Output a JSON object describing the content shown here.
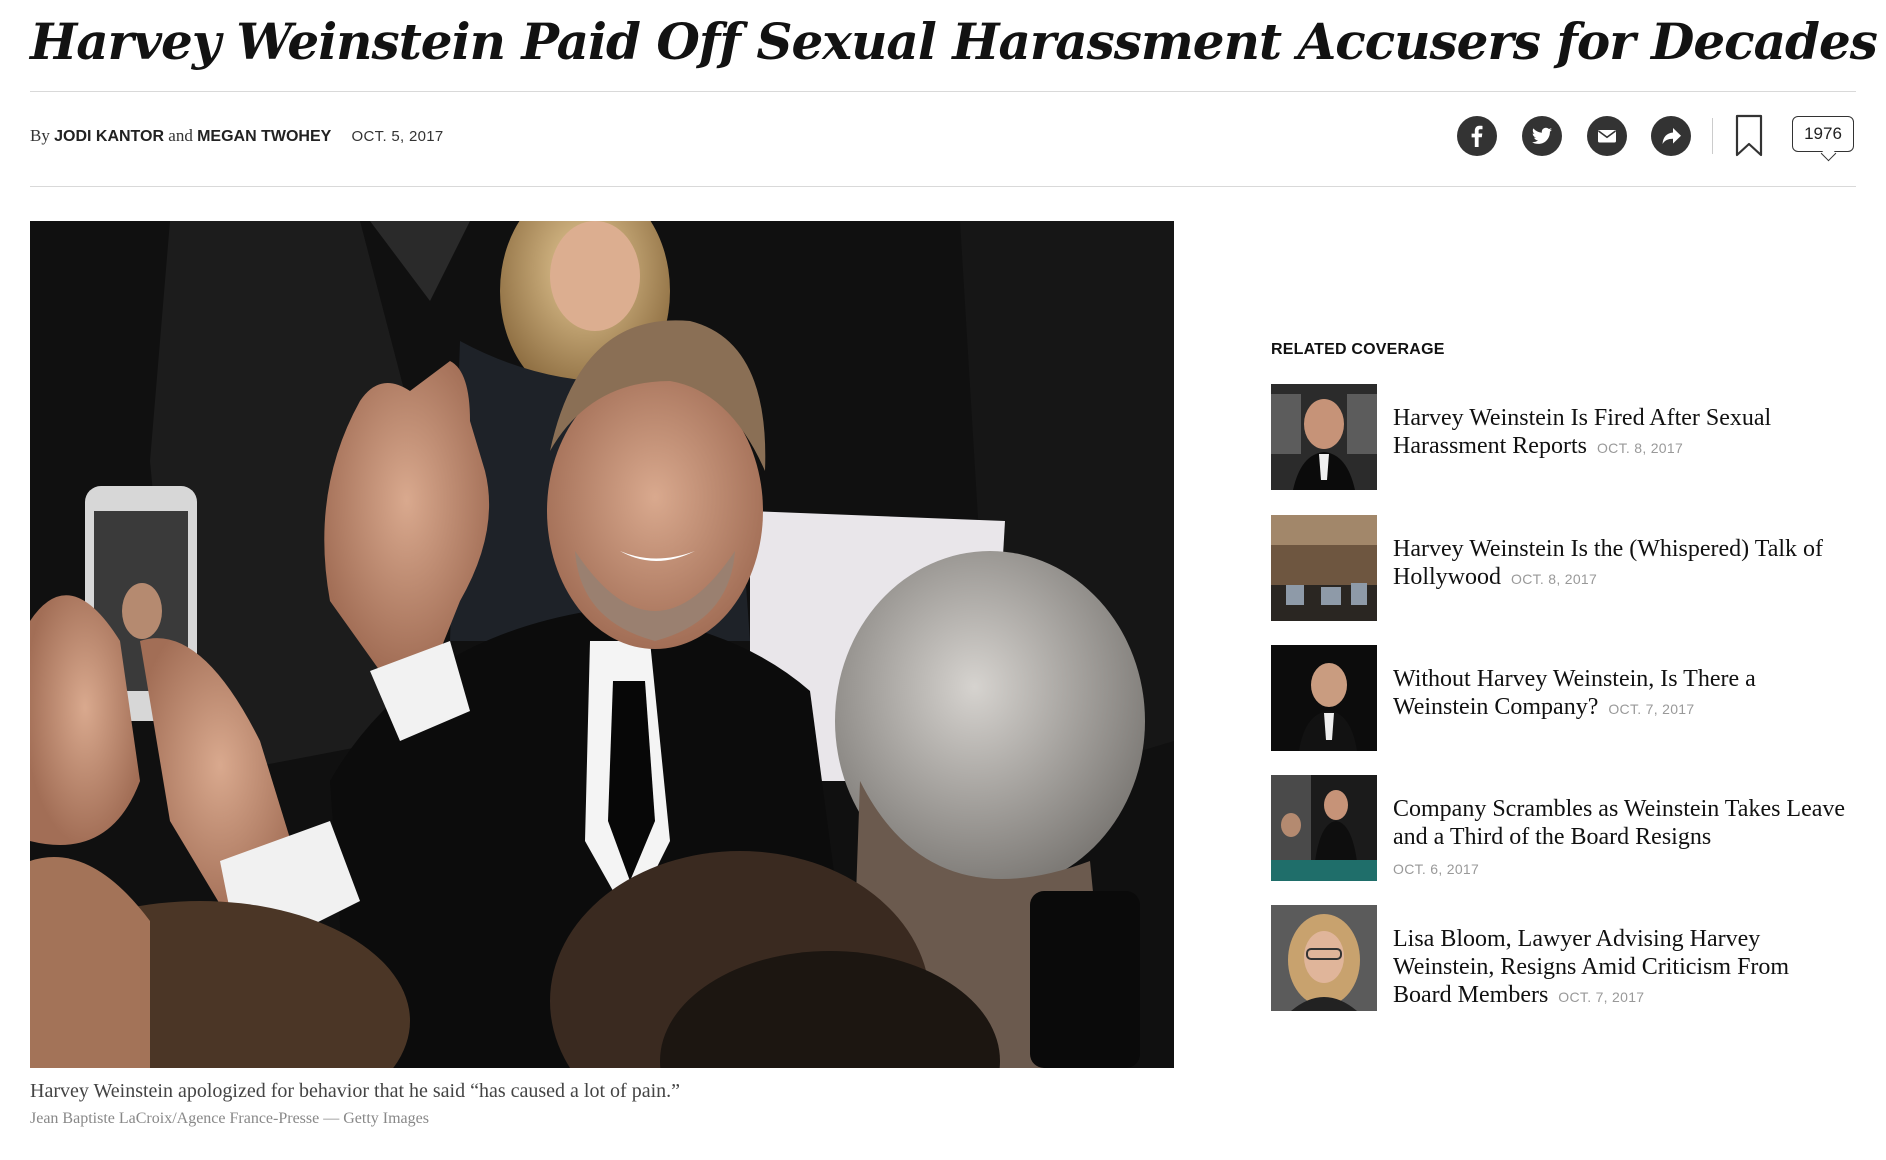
{
  "article": {
    "headline": "Harvey Weinstein Paid Off Sexual Harassment Accusers for Decades",
    "byline_prefix": "By",
    "author1": "JODI KANTOR",
    "byline_and": "and",
    "author2": "MEGAN TWOHEY",
    "date": "OCT. 5, 2017"
  },
  "toolbar": {
    "share_icons": [
      "facebook-icon",
      "twitter-icon",
      "email-icon",
      "share-icon"
    ],
    "bookmark_icon": "bookmark-icon",
    "comment_count": "1976"
  },
  "photo": {
    "caption": "Harvey Weinstein apologized for behavior that he said “has caused a lot of pain.”",
    "credit": "Jean Baptiste LaCroix/Agence France-Presse — Getty Images"
  },
  "related": {
    "label": "RELATED COVERAGE",
    "items": [
      {
        "title": "Harvey Weinstein Is Fired After Sexual Harassment Reports",
        "date": "OCT. 8, 2017"
      },
      {
        "title": "Harvey Weinstein Is the (Whispered) Talk of Hollywood",
        "date": "OCT. 8, 2017"
      },
      {
        "title": "Without Harvey Weinstein, Is There a Weinstein Company?",
        "date": "OCT. 7, 2017"
      },
      {
        "title": "Company Scrambles as Weinstein Takes Leave and a Third of the Board Resigns",
        "date": "OCT. 6, 2017"
      },
      {
        "title": "Lisa Bloom, Lawyer Advising Harvey Weinstein, Resigns Amid Criticism From Board Members",
        "date": "OCT. 7, 2017"
      }
    ]
  },
  "colors": {
    "text": "#121212",
    "rule": "#d9d9d9",
    "icon_bg": "#333333",
    "muted": "#999999"
  }
}
